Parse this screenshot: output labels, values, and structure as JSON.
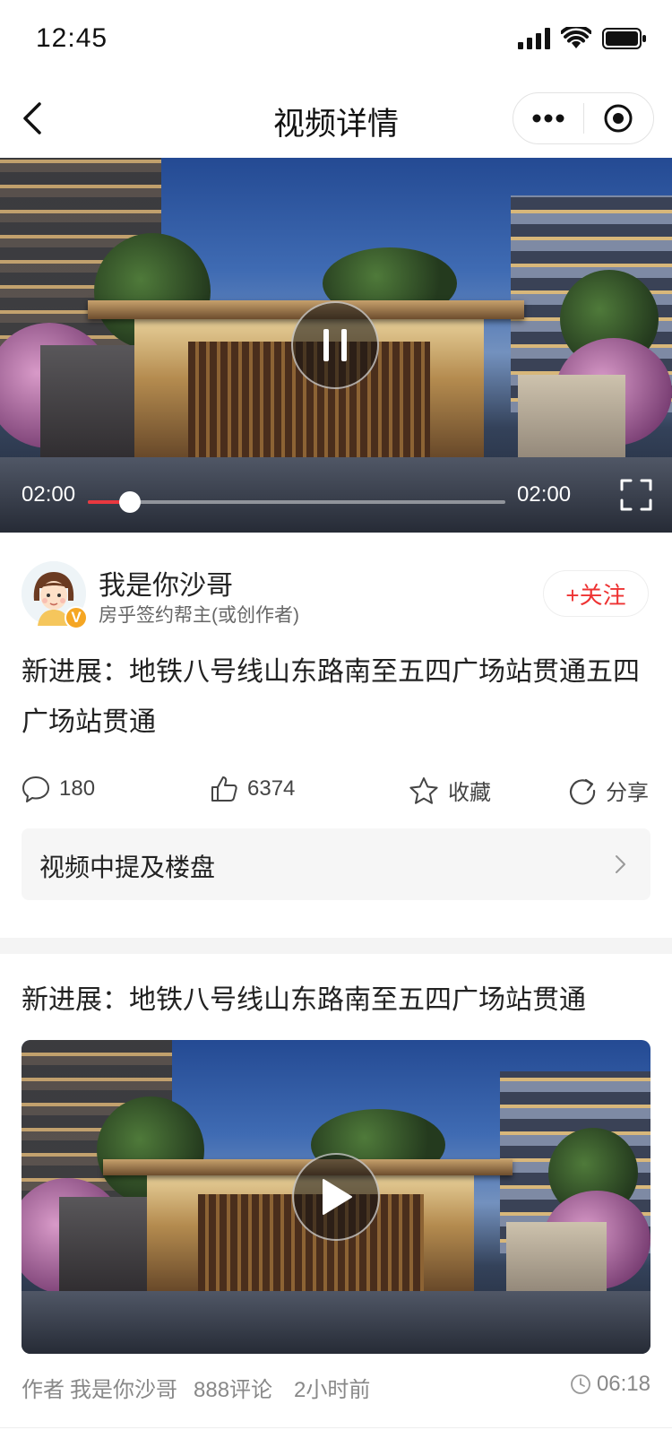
{
  "status_bar": {
    "time": "12:45"
  },
  "nav": {
    "title": "视频详情"
  },
  "player": {
    "current_time": "02:00",
    "total_time": "02:00",
    "progress": 0.1,
    "state": "playing"
  },
  "author": {
    "name": "我是你沙哥",
    "role": "房乎签约帮主(或创作者)",
    "verify_badge": "V",
    "follow_label": "+关注"
  },
  "video": {
    "title": "新进展：地铁八号线山东路南至五四广场站贯通五四广场站贯通"
  },
  "actions": {
    "comments": "180",
    "likes": "6374",
    "favorite_label": "收藏",
    "share_label": "分享"
  },
  "mentioned": {
    "label": "视频中提及楼盘"
  },
  "recommend": {
    "title": "新进展：地铁八号线山东路南至五四广场站贯通",
    "author_prefix": "作者",
    "author": "我是你沙哥",
    "comments": "888评论",
    "time_ago": "2小时前",
    "duration": "06:18"
  },
  "colors": {
    "accent": "#e33333",
    "progress": "#e9383f",
    "verify": "#f5a623"
  }
}
